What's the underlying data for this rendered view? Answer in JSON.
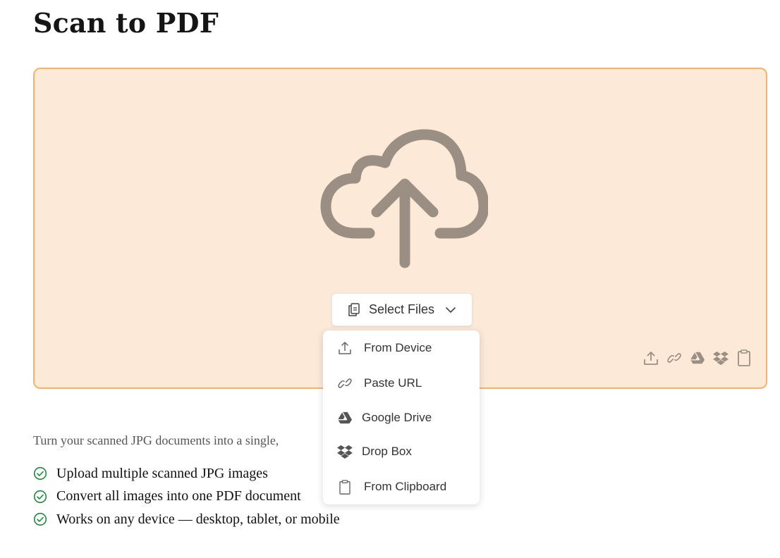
{
  "page": {
    "title": "Scan to PDF"
  },
  "upload": {
    "select_button_label": "Select Files",
    "quick_icons": [
      "upload-icon",
      "link-icon",
      "google-drive-icon",
      "dropbox-icon",
      "clipboard-icon"
    ],
    "dropzone_bg": "#fde9d8",
    "dropzone_border": "#f5b46c",
    "icon_color": "#9b8f83"
  },
  "dropdown": {
    "items": [
      {
        "label": "From Device",
        "icon": "upload-icon"
      },
      {
        "label": "Paste URL",
        "icon": "link-icon"
      },
      {
        "label": "Google Drive",
        "icon": "google-drive-icon"
      },
      {
        "label": "Drop Box",
        "icon": "dropbox-icon"
      },
      {
        "label": "From Clipboard",
        "icon": "clipboard-icon"
      }
    ]
  },
  "content": {
    "intro": "Turn your scanned JPG documents into a single,",
    "features": [
      "Upload multiple scanned JPG images",
      "Convert all images into one PDF document",
      "Works on any device — desktop, tablet, or mobile"
    ],
    "check_color": "#1f8a3b"
  }
}
